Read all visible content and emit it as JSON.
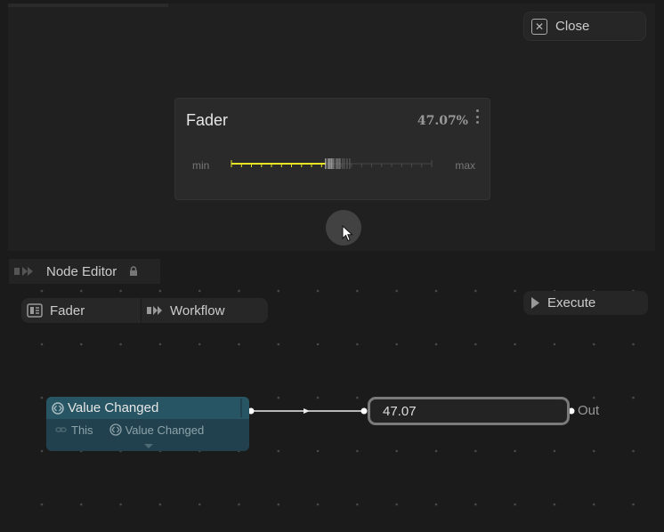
{
  "dashboard": {
    "close_label": "Close"
  },
  "fader": {
    "title": "Fader",
    "percent_label": "47.07%",
    "value_fraction": 0.4707,
    "min_label": "min",
    "max_label": "max",
    "fill_color": "#e8e323"
  },
  "editor": {
    "title": "Node Editor",
    "tabs": [
      {
        "label": "Fader",
        "icon": "panel-icon"
      },
      {
        "label": "Workflow",
        "icon": "workflow-icon"
      }
    ],
    "execute_label": "Execute"
  },
  "event_node": {
    "title": "Value Changed",
    "source_label": "This",
    "event_label": "Value Changed"
  },
  "value_node": {
    "value": "47.07",
    "output_label": "Out"
  }
}
